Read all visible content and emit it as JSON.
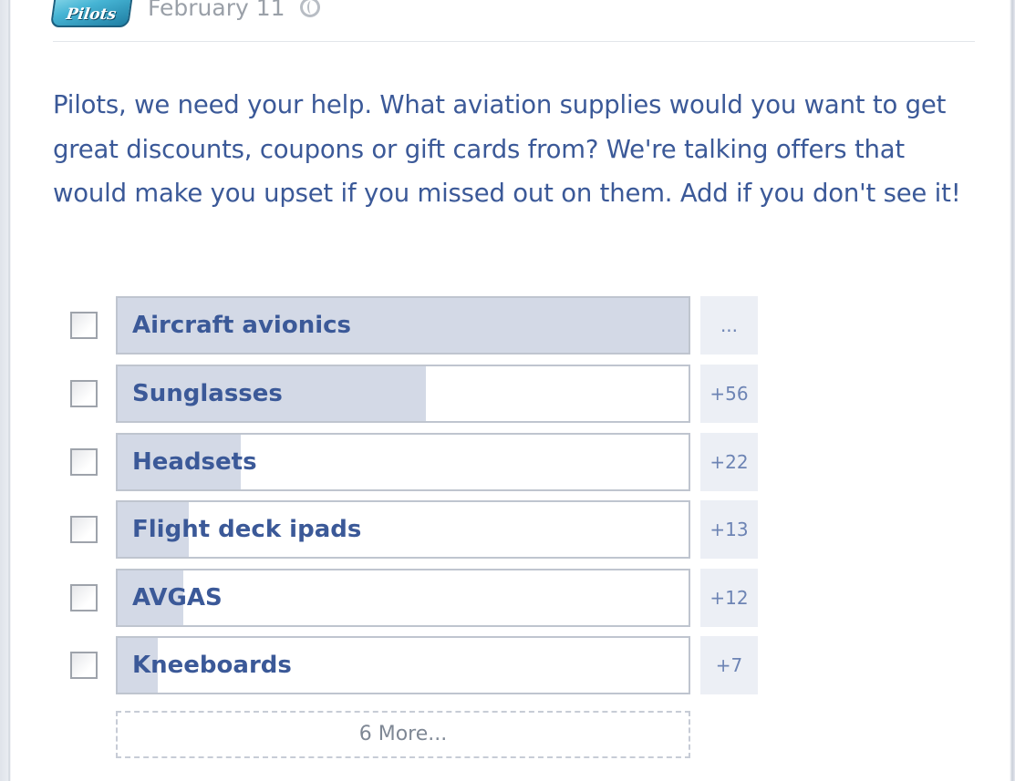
{
  "post": {
    "page_logo_text": "Pilots",
    "date": "February 11",
    "message": "Pilots, we need your help. What aviation supplies would you want to get great discounts, coupons or gift cards from? We're talking offers that would make you upset if you missed out on them. Add if you don't see it!"
  },
  "poll": {
    "options": [
      {
        "label": "Aircraft avionics",
        "count": "...",
        "fill_fraction": 1.0
      },
      {
        "label": "Sunglasses",
        "count": "+56",
        "fill_fraction": 0.54
      },
      {
        "label": "Headsets",
        "count": "+22",
        "fill_fraction": 0.215
      },
      {
        "label": "Flight deck ipads",
        "count": "+13",
        "fill_fraction": 0.125
      },
      {
        "label": "AVGAS",
        "count": "+12",
        "fill_fraction": 0.115
      },
      {
        "label": "Kneeboards",
        "count": "+7",
        "fill_fraction": 0.07
      }
    ],
    "more_label": "6 More..."
  },
  "colors": {
    "text_blue": "#3b5998",
    "bar_fill": "#d3d9e6",
    "count_bg": "#eceff5",
    "date_gray": "#9aa0a8"
  },
  "icons": {
    "privacy": "globe-icon"
  }
}
